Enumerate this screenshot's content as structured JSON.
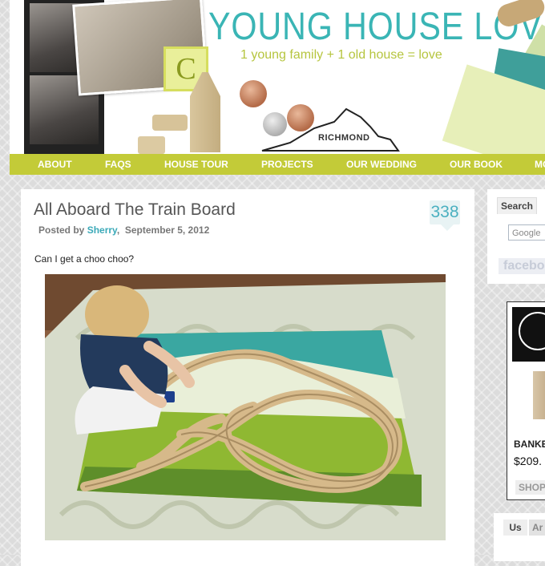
{
  "header": {
    "title": "YOUNG HOUSE LOVE",
    "tagline": "1 young family + 1 old house = love",
    "block_letter": "C",
    "map_label": "RICHMOND"
  },
  "nav": {
    "items": [
      {
        "label": "ABOUT"
      },
      {
        "label": "FAQS"
      },
      {
        "label": "HOUSE TOUR"
      },
      {
        "label": "PROJECTS"
      },
      {
        "label": "OUR WEDDING"
      },
      {
        "label": "OUR BOOK"
      },
      {
        "label": "MO"
      }
    ]
  },
  "post": {
    "title": "All Aboard The Train Board",
    "posted_by_label": "Posted by",
    "author": "Sherry",
    "date": "September 5, 2012",
    "comment_count": "338",
    "intro": "Can I get a choo choo?"
  },
  "sidebar": {
    "search_tab": "Search",
    "search_placeholder": "Google",
    "facebook_label": "facebo",
    "ad": {
      "product_name": "BANKE",
      "price": "$209.",
      "shop_label": "SHOP"
    },
    "tabs2": [
      "Us",
      "Ar"
    ]
  },
  "colors": {
    "nav_bg": "#c3cb38",
    "title_teal": "#3ab5b5",
    "tagline_green": "#b6c53f",
    "author_link": "#3aa9b8",
    "comment_badge_bg": "#e8f3f4"
  },
  "icons": [
    "comment-bubble-icon"
  ]
}
